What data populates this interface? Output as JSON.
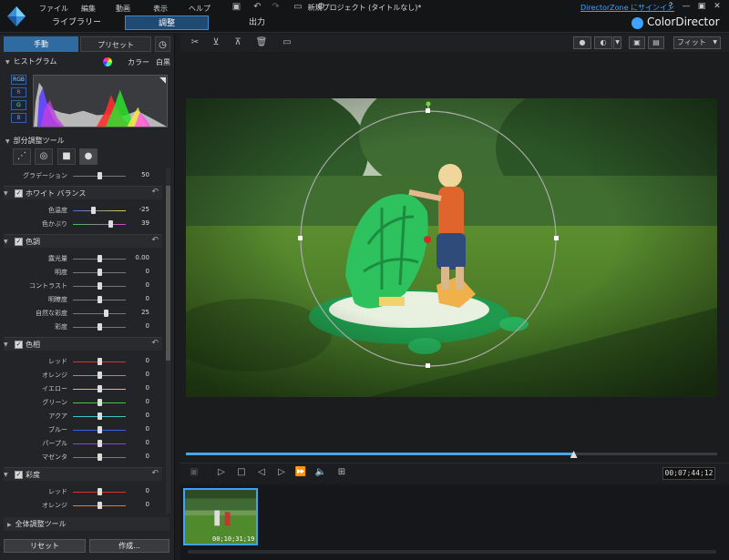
{
  "menu": [
    "ファイル",
    "編集",
    "動画",
    "表示",
    "ヘルプ"
  ],
  "modes": {
    "library": "ライブラリー",
    "edit": "調整",
    "output": "出力"
  },
  "project_title": "新規プロジェクト (タイトルなし)*",
  "signin": "DirectorZone にサインイン",
  "help": "?",
  "brand": "ColorDirector",
  "left_tabs": {
    "manual": "手動",
    "preset": "プリセット"
  },
  "histogram": {
    "title": "ヒストグラム",
    "color": "カラー",
    "bw": "白黒",
    "channels": [
      "RGB",
      "R",
      "G",
      "B"
    ]
  },
  "partial_tool": "部分調整ツール",
  "gradation": {
    "label": "グラデーション",
    "value": 50
  },
  "white_balance": {
    "title": "ホワイト バランス",
    "rows": [
      {
        "label": "色温度",
        "value": "-25",
        "pos": 0.38
      },
      {
        "label": "色かぶり",
        "value": "39",
        "pos": 0.7
      }
    ]
  },
  "tone": {
    "title": "色調",
    "rows": [
      {
        "label": "露光量",
        "value": "0.00",
        "pos": 0.5
      },
      {
        "label": "明度",
        "value": "0",
        "pos": 0.5
      },
      {
        "label": "コントラスト",
        "value": "0",
        "pos": 0.5
      },
      {
        "label": "明瞭度",
        "value": "0",
        "pos": 0.5
      },
      {
        "label": "自然な彩度",
        "value": "25",
        "pos": 0.62
      },
      {
        "label": "彩度",
        "value": "0",
        "pos": 0.5
      }
    ]
  },
  "hue": {
    "title": "色相",
    "rows": [
      {
        "label": "レッド",
        "value": "0"
      },
      {
        "label": "オレンジ",
        "value": "0"
      },
      {
        "label": "イエロー",
        "value": "0"
      },
      {
        "label": "グリーン",
        "value": "0"
      },
      {
        "label": "アクア",
        "value": "0"
      },
      {
        "label": "ブルー",
        "value": "0"
      },
      {
        "label": "パープル",
        "value": "0"
      },
      {
        "label": "マゼンタ",
        "value": "0"
      }
    ]
  },
  "saturation": {
    "title": "彩度",
    "rows": [
      {
        "label": "レッド",
        "value": "0"
      },
      {
        "label": "オレンジ",
        "value": "0"
      }
    ]
  },
  "global_tool": "全体調整ツール",
  "reset": "リセット",
  "create": "作成...",
  "fit": "フィット",
  "seek_progress": 0.73,
  "timecode": "00;07;44;12",
  "thumb_time": "00;10;31;19",
  "colors": {
    "accent": "#3ea2ff",
    "panel": "#232427",
    "active_tab": "#2f6aa0"
  }
}
